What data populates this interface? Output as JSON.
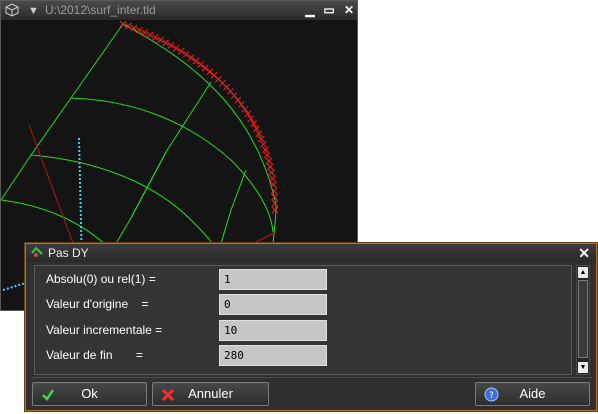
{
  "viewport": {
    "title": "U:\\2012\\surf_inter.tld",
    "icons": [
      "cube-icon",
      "dropdown-triangle-icon",
      "minimize-icon",
      "maximize-icon",
      "close-icon"
    ],
    "background_color": "#141414",
    "colors": {
      "mesh": "#22dd22",
      "markers": "#ff2020",
      "curve": "#40d0f0",
      "axis": "#b01818"
    }
  },
  "dialog": {
    "title": "Pas DY",
    "icons": [
      "dialog-app-icon",
      "close-icon",
      "scroll-up-icon",
      "scroll-down-icon"
    ],
    "fields": [
      {
        "label": "Absolu(0) ou rel(1) =",
        "value": "1"
      },
      {
        "label": "Valeur d'origine    =",
        "value": "0"
      },
      {
        "label": "Valeur incrementale =",
        "value": "10"
      },
      {
        "label": "Valeur de fin       =",
        "value": "280"
      }
    ],
    "buttons": {
      "ok": {
        "label": "Ok",
        "icon": "checkmark-icon"
      },
      "cancel": {
        "label": "Annuler",
        "icon": "cancel-x-icon"
      },
      "help": {
        "label": "Aide",
        "icon": "help-icon"
      }
    },
    "accent_border": "#b5722a"
  }
}
